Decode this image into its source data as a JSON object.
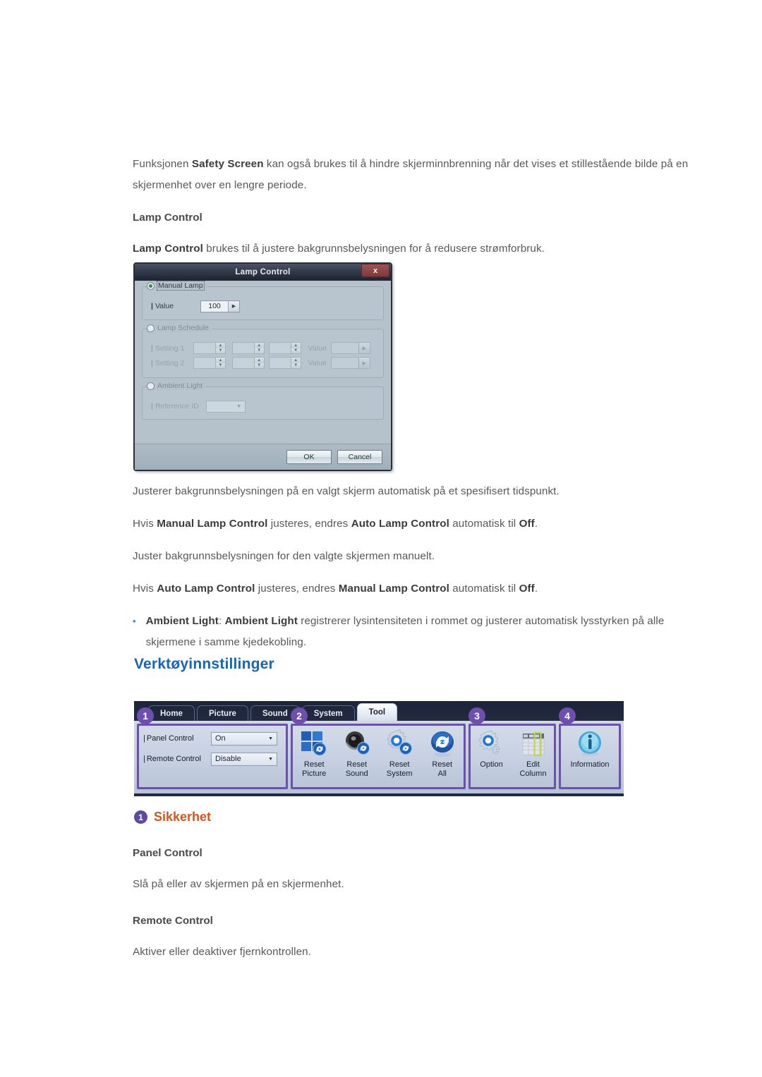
{
  "intro": {
    "p1_pre": "Funksjonen ",
    "p1_b": "Safety Screen",
    "p1_post": " kan også brukes til å hindre skjerminnbrenning når det vises et stillestående bilde på en skjermenhet over en lengre periode.",
    "lamp_heading": "Lamp Control",
    "p2_b": "Lamp Control",
    "p2_post": " brukes til å justere bakgrunnsbelysningen for å redusere strømforbruk."
  },
  "dialog": {
    "title": "Lamp Control",
    "close_label": "x",
    "manual": {
      "legend": "Manual Lamp",
      "value_label": "Value",
      "value": "100"
    },
    "schedule": {
      "legend": "Lamp Schedule",
      "rows": [
        {
          "label": "Setting 1",
          "value_label": "Value"
        },
        {
          "label": "Setting 2",
          "value_label": "Value"
        }
      ]
    },
    "ambient": {
      "legend": "Ambient Light",
      "reference_label": "Reference ID"
    },
    "ok_label": "OK",
    "cancel_label": "Cancel"
  },
  "notes": {
    "n1": "Justerer bakgrunnsbelysningen på en valgt skjerm automatisk på et spesifisert tidspunkt.",
    "n2_pre": "Hvis ",
    "n2_b1": "Manual Lamp Control",
    "n2_mid": " justeres, endres ",
    "n2_b2": "Auto Lamp Control",
    "n2_mid2": " automatisk til ",
    "n2_b3": "Off",
    "n2_end": ".",
    "n3": "Juster bakgrunnsbelysningen for den valgte skjermen manuelt.",
    "n4_pre": "Hvis ",
    "n4_b1": "Auto Lamp Control",
    "n4_mid": " justeres, endres ",
    "n4_b2": "Manual Lamp Control",
    "n4_mid2": " automatisk til ",
    "n4_b3": "Off",
    "n4_end": ".",
    "bullet_b1": "Ambient Light",
    "bullet_mid": ": ",
    "bullet_b2": "Ambient Light",
    "bullet_rest": " registrerer lysintensiteten i rommet og justerer automatisk lysstyrken på alle skjermene i samme kjedekobling."
  },
  "section": {
    "title": "Verktøyinnstillinger"
  },
  "toolbar": {
    "tabs": [
      {
        "label": "Home",
        "active": false
      },
      {
        "label": "Picture",
        "active": false
      },
      {
        "label": "Sound",
        "active": false
      },
      {
        "label": "System",
        "active": false
      },
      {
        "label": "Tool",
        "active": true
      }
    ],
    "badges": [
      "1",
      "2",
      "3",
      "4"
    ],
    "pane1": {
      "rows": [
        {
          "label": "Panel Control",
          "value": "On"
        },
        {
          "label": "Remote Control",
          "value": "Disable"
        }
      ]
    },
    "pane2": {
      "items": [
        {
          "icon": "reset-picture-icon",
          "line1": "Reset",
          "line2": "Picture"
        },
        {
          "icon": "reset-sound-icon",
          "line1": "Reset",
          "line2": "Sound"
        },
        {
          "icon": "reset-system-icon",
          "line1": "Reset",
          "line2": "System"
        },
        {
          "icon": "reset-all-icon",
          "line1": "Reset",
          "line2": "All"
        }
      ]
    },
    "pane3": {
      "items": [
        {
          "icon": "option-gear-icon",
          "line1": "Option",
          "line2": ""
        },
        {
          "icon": "edit-column-icon",
          "line1": "Edit",
          "line2": "Column"
        }
      ]
    },
    "pane4": {
      "items": [
        {
          "icon": "information-icon",
          "line1": "Information",
          "line2": ""
        }
      ]
    },
    "accent_purple": "#6d4fae",
    "tab_active_bg": "#eef2f8"
  },
  "sikkerhet": {
    "badge": "1",
    "title": "Sikkerhet",
    "panel_control_heading": "Panel Control",
    "panel_control_text": "Slå på eller av skjermen på en skjermenhet.",
    "remote_control_heading": "Remote Control",
    "remote_control_text": "Aktiver eller deaktiver fjernkontrollen."
  }
}
